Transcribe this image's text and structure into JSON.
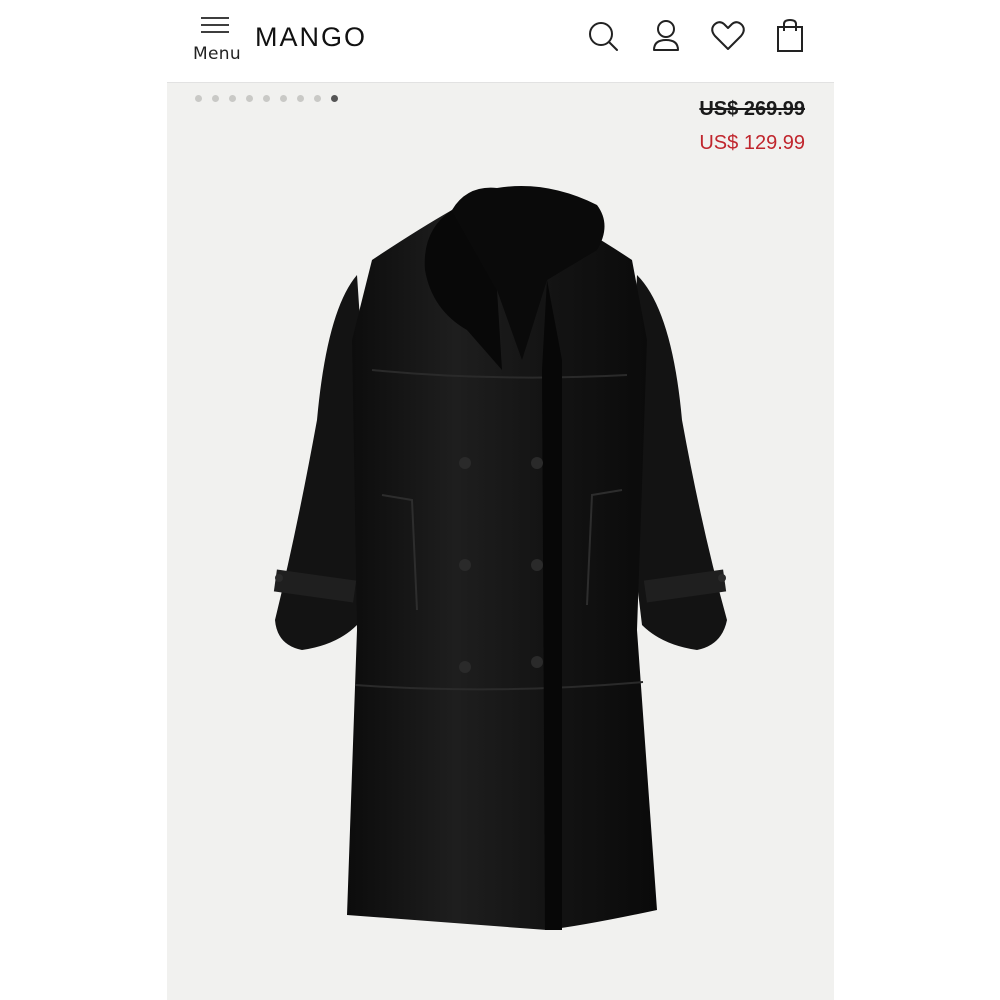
{
  "header": {
    "menu_label": "Menu",
    "logo": "MANGO",
    "icons": [
      "search-icon",
      "account-icon",
      "wishlist-heart-icon",
      "shopping-bag-icon"
    ]
  },
  "gallery": {
    "total_images": 9,
    "active_index": 9
  },
  "product": {
    "original_price": "US$ 269.99",
    "sale_price": "US$ 129.99",
    "image": "black shearling double-breasted long coat"
  },
  "colors": {
    "sale_price": "#c0262d",
    "background": "#f1f1ef",
    "coat": "#161616"
  }
}
